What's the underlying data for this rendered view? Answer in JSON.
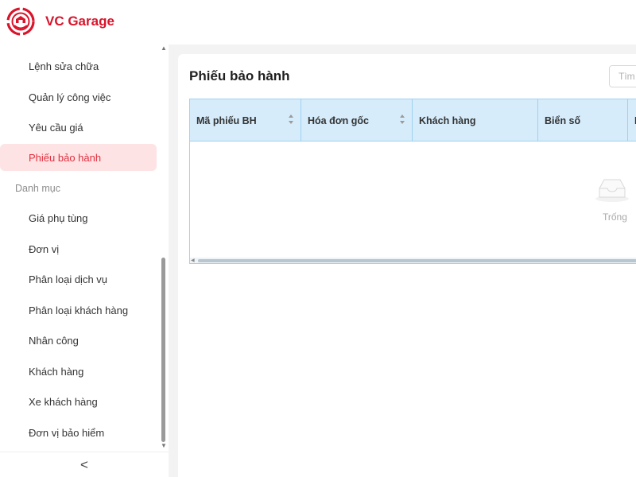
{
  "app": {
    "brand": "VC Garage",
    "logo_icon": "garage-logo-icon",
    "accent_color": "#d9142b"
  },
  "sidebar": {
    "items": [
      {
        "label": "Lệnh sửa chữa",
        "active": false
      },
      {
        "label": "Quản lý công việc",
        "active": false
      },
      {
        "label": "Yêu cầu giá",
        "active": false
      },
      {
        "label": "Phiếu bảo hành",
        "active": true
      }
    ],
    "group_label": "Danh mục",
    "group_items": [
      {
        "label": "Giá phụ tùng"
      },
      {
        "label": "Đơn vị"
      },
      {
        "label": "Phân loại dịch vụ"
      },
      {
        "label": "Phân loại khách hàng"
      },
      {
        "label": "Nhân công"
      },
      {
        "label": "Khách hàng"
      },
      {
        "label": "Xe khách hàng"
      },
      {
        "label": "Đơn vị bảo hiểm"
      }
    ],
    "collapse_glyph": "<"
  },
  "main": {
    "title": "Phiếu bảo hành",
    "search": {
      "placeholder": "Tìm"
    },
    "table": {
      "columns": [
        {
          "label": "Mã phiếu BH",
          "sortable": true
        },
        {
          "label": "Hóa đơn gốc",
          "sortable": true
        },
        {
          "label": "Khách hàng",
          "sortable": false
        },
        {
          "label": "Biển số",
          "sortable": false
        },
        {
          "label": "N",
          "sortable": false
        }
      ],
      "rows": [],
      "empty_text": "Trống",
      "empty_icon": "empty-inbox-icon"
    }
  }
}
